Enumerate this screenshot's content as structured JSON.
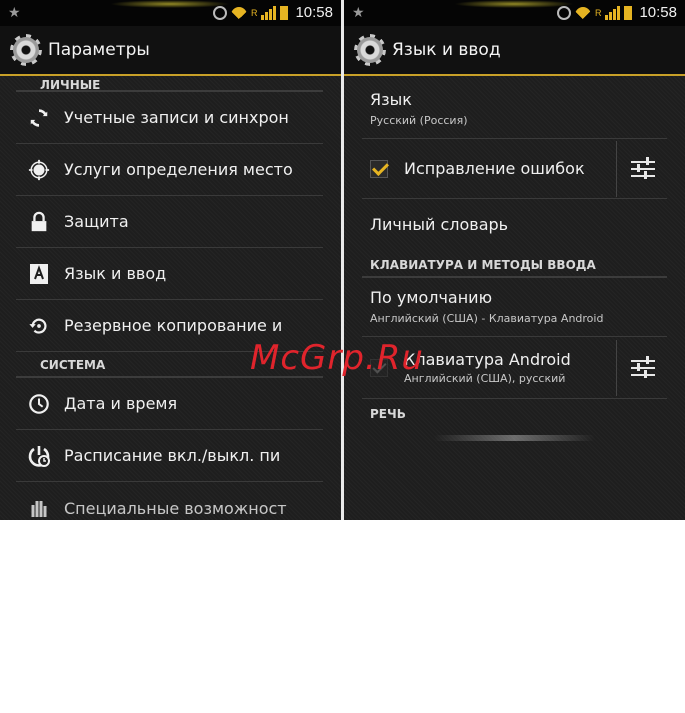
{
  "status_bar": {
    "time": "10:58",
    "network_label": "R"
  },
  "left_screen": {
    "title": "Параметры",
    "cut_section": "ЛИЧНЫЕ",
    "personal_items": [
      {
        "label": "Учетные записи и синхрон",
        "icon": "sync-icon"
      },
      {
        "label": "Услуги определения место",
        "icon": "location-icon"
      },
      {
        "label": "Защита",
        "icon": "lock-icon"
      },
      {
        "label": "Язык и ввод",
        "icon": "language-icon"
      },
      {
        "label": "Резервное копирование и",
        "icon": "backup-icon"
      }
    ],
    "system_section": "СИСТЕМА",
    "system_items": [
      {
        "label": "Дата и время",
        "icon": "clock-icon"
      },
      {
        "label": "Расписание вкл./выкл. пи",
        "icon": "power-schedule-icon"
      },
      {
        "label": "Специальные возможност",
        "icon": "accessibility-icon"
      }
    ]
  },
  "right_screen": {
    "title": "Язык и ввод",
    "language": {
      "title": "Язык",
      "value": "Русский (Россия)"
    },
    "spellcheck": {
      "label": "Исправление ошибок",
      "checked": true
    },
    "dictionary": "Личный словарь",
    "keyboard_section": "КЛАВИАТУРА И МЕТОДЫ ВВОДА",
    "default": {
      "title": "По умолчанию",
      "value": "Английский (США) - Клавиатура Android"
    },
    "android_keyboard": {
      "title": "Клавиатура Android",
      "value": "Английский (США), русский",
      "checked": true
    },
    "speech_section": "РЕЧЬ"
  },
  "watermark": "McGrp.Ru",
  "colors": {
    "accent": "#e6b422",
    "background": "#1e1e1e",
    "action_bar_line": "#c8a028"
  }
}
